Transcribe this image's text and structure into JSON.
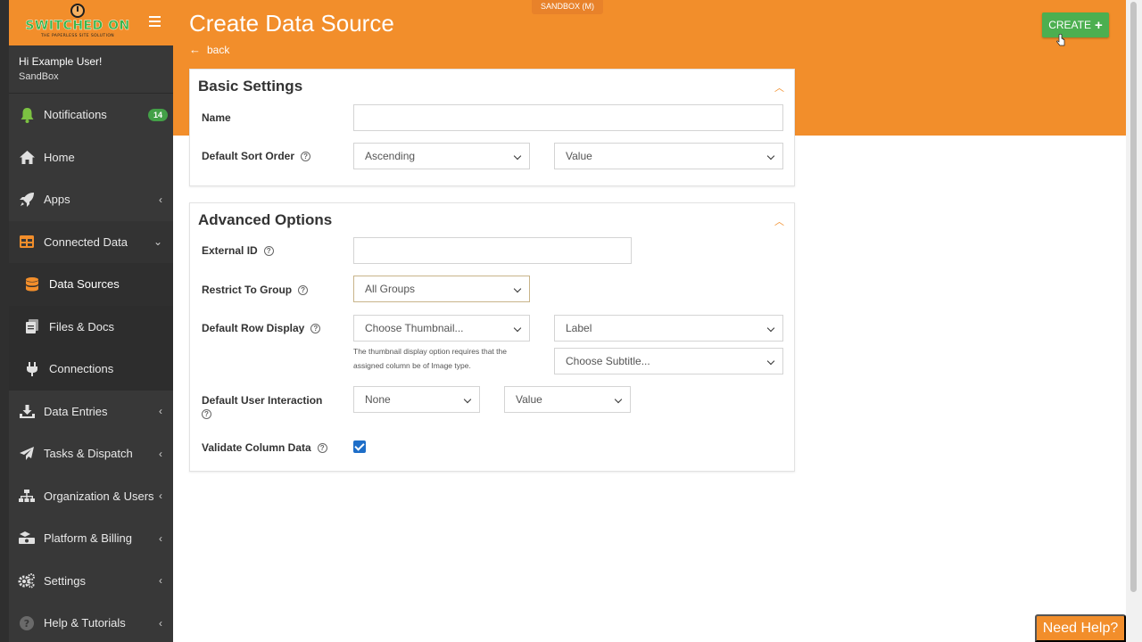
{
  "brand": {
    "name": "SWITCHED ON",
    "tagline": "THE PAPERLESS SITE SOLUTION"
  },
  "user": {
    "greeting": "Hi Example User!",
    "org": "SandBox"
  },
  "sidebar": {
    "items": [
      {
        "label": "Notifications",
        "icon": "bell-icon",
        "badge": "14"
      },
      {
        "label": "Home",
        "icon": "home-icon"
      },
      {
        "label": "Apps",
        "icon": "rocket-icon"
      },
      {
        "label": "Connected Data",
        "icon": "table-icon"
      },
      {
        "label": "Data Sources",
        "icon": "database-icon"
      },
      {
        "label": "Files & Docs",
        "icon": "files-icon"
      },
      {
        "label": "Connections",
        "icon": "plug-icon"
      },
      {
        "label": "Data Entries",
        "icon": "download-icon"
      },
      {
        "label": "Tasks & Dispatch",
        "icon": "paper-plane-icon"
      },
      {
        "label": "Organization & Users",
        "icon": "sitemap-icon"
      },
      {
        "label": "Platform & Billing",
        "icon": "cash-icon"
      },
      {
        "label": "Settings",
        "icon": "gears-icon"
      },
      {
        "label": "Help & Tutorials",
        "icon": "question-icon"
      }
    ]
  },
  "header": {
    "env_tag": "SANDBOX (M)",
    "title": "Create Data Source",
    "back": "back",
    "create": "CREATE"
  },
  "basic": {
    "title": "Basic Settings",
    "name_label": "Name",
    "name_value": "",
    "sort_label": "Default Sort Order",
    "sort_value": "Ascending",
    "sort_column": "Value"
  },
  "advanced": {
    "title": "Advanced Options",
    "external_id_label": "External ID",
    "external_id_value": "",
    "group_label": "Restrict To Group",
    "group_value": "All Groups",
    "row_display_label": "Default Row Display",
    "thumbnail_value": "Choose Thumbnail...",
    "thumbnail_help": "The thumbnail display option requires that the assigned column be of Image type.",
    "row_label_value": "Label",
    "subtitle_value": "Choose Subtitle...",
    "interaction_label": "Default User Interaction",
    "interaction_value": "None",
    "interaction_column": "Value",
    "validate_label": "Validate Column Data",
    "validate_checked": true
  },
  "need_help": "Need Help?",
  "colors": {
    "accent": "#f28e2b",
    "sidebar": "#383838",
    "create": "#4caf50",
    "badge": "#43a047",
    "checkbox": "#1e6ec8"
  }
}
